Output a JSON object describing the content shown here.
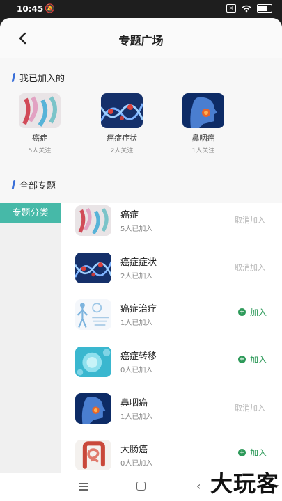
{
  "status_bar": {
    "time": "10:45"
  },
  "header": {
    "title": "专题广场"
  },
  "joined": {
    "title": "我已加入的",
    "items": [
      {
        "name": "癌症",
        "count": "5人关注",
        "image": "ribbons"
      },
      {
        "name": "癌症症状",
        "count": "2人关注",
        "image": "dna"
      },
      {
        "name": "鼻咽癌",
        "count": "1人关注",
        "image": "head"
      }
    ]
  },
  "all_topics": {
    "title": "全部专题",
    "category_tab": "专题分类"
  },
  "topics": [
    {
      "name": "癌症",
      "count": "5人已加入",
      "action": "取消加入",
      "joined": true,
      "image": "ribbons"
    },
    {
      "name": "癌症症状",
      "count": "2人已加入",
      "action": "取消加入",
      "joined": true,
      "image": "dna"
    },
    {
      "name": "癌症治疗",
      "count": "1人已加入",
      "action": "加入",
      "joined": false,
      "image": "medical"
    },
    {
      "name": "癌症转移",
      "count": "0人已加入",
      "action": "加入",
      "joined": false,
      "image": "cells"
    },
    {
      "name": "鼻咽癌",
      "count": "1人已加入",
      "action": "取消加入",
      "joined": true,
      "image": "head"
    },
    {
      "name": "大肠癌",
      "count": "0人已加入",
      "action": "加入",
      "joined": false,
      "image": "intestine"
    }
  ],
  "watermark": "大玩客",
  "colors": {
    "accent": "#46b9a8",
    "join_green": "#2e9a5a",
    "section_bar": "#3a6fd8"
  }
}
